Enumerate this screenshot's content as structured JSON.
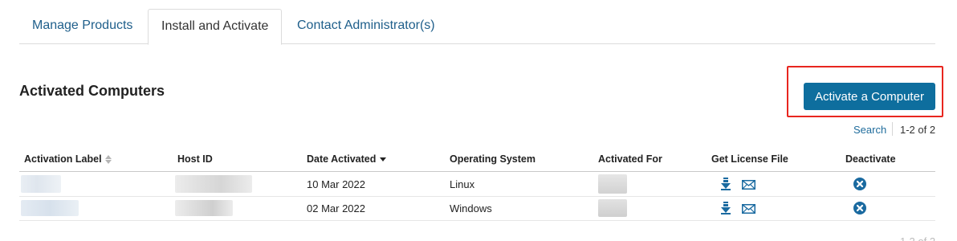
{
  "tabs": [
    {
      "label": "Manage Products"
    },
    {
      "label": "Install and Activate"
    },
    {
      "label": "Contact Administrator(s)"
    }
  ],
  "section_title": "Activated Computers",
  "activate_button": "Activate a Computer",
  "search_label": "Search",
  "pagination": "1-2 of 2",
  "table": {
    "headers": [
      "Activation Label",
      "Host ID",
      "Date Activated",
      "Operating System",
      "Activated For",
      "Get License File",
      "Deactivate"
    ],
    "sorted_column": "Date Activated",
    "rows": [
      {
        "date": "10 Mar 2022",
        "os": "Linux"
      },
      {
        "date": "02 Mar 2022",
        "os": "Windows"
      }
    ]
  },
  "icons": {
    "download": "download-icon",
    "email": "envelope-icon",
    "deactivate": "circle-x-icon"
  },
  "colors": {
    "primary": "#0e6e9e",
    "link": "#1f6c9c",
    "highlight": "#e8261f"
  }
}
